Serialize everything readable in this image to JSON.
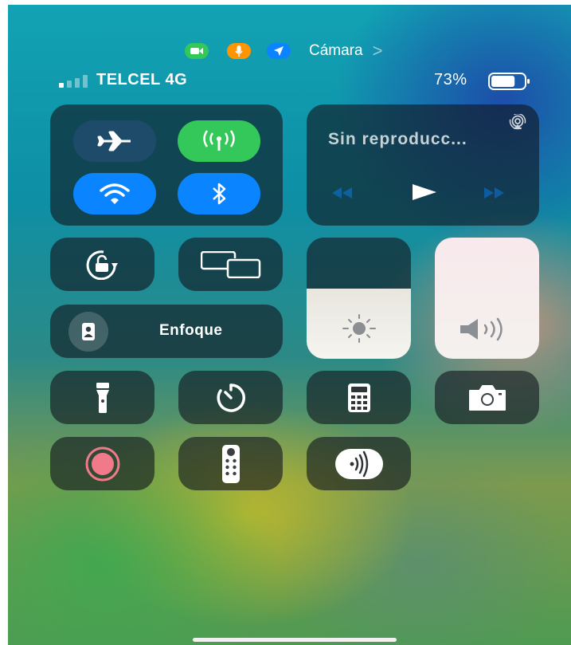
{
  "privacy": {
    "app_label": "Cámara",
    "camera_color": "#34c759",
    "mic_color": "#ff9500",
    "location_color": "#0a84ff"
  },
  "status": {
    "carrier": "TELCEL 4G",
    "battery_text": "73%",
    "battery_level": 0.73
  },
  "connectivity": {
    "airplane": {
      "icon": "airplane-icon",
      "on": false
    },
    "cellular": {
      "icon": "antenna-icon",
      "on": true,
      "color": "#34c759"
    },
    "wifi": {
      "icon": "wifi-icon",
      "on": true,
      "color": "#0a84ff"
    },
    "bluetooth": {
      "icon": "bluetooth-icon",
      "on": true,
      "color": "#0a84ff"
    }
  },
  "media": {
    "now_playing": "Sin reproducc...",
    "airplay_icon": "airplay-icon",
    "controls": [
      "rewind-icon",
      "play-icon",
      "fast-forward-icon"
    ]
  },
  "controls": {
    "orientation_lock": "orientation-lock-icon",
    "screen_mirroring": "screen-mirroring-icon",
    "focus_label": "Enfoque",
    "brightness_level": 0.58,
    "volume_level": 1.0
  },
  "shortcuts": [
    "flashlight-icon",
    "timer-icon",
    "calculator-icon",
    "camera-icon",
    "screen-record-icon",
    "apple-tv-remote-icon",
    "nfc-icon"
  ]
}
